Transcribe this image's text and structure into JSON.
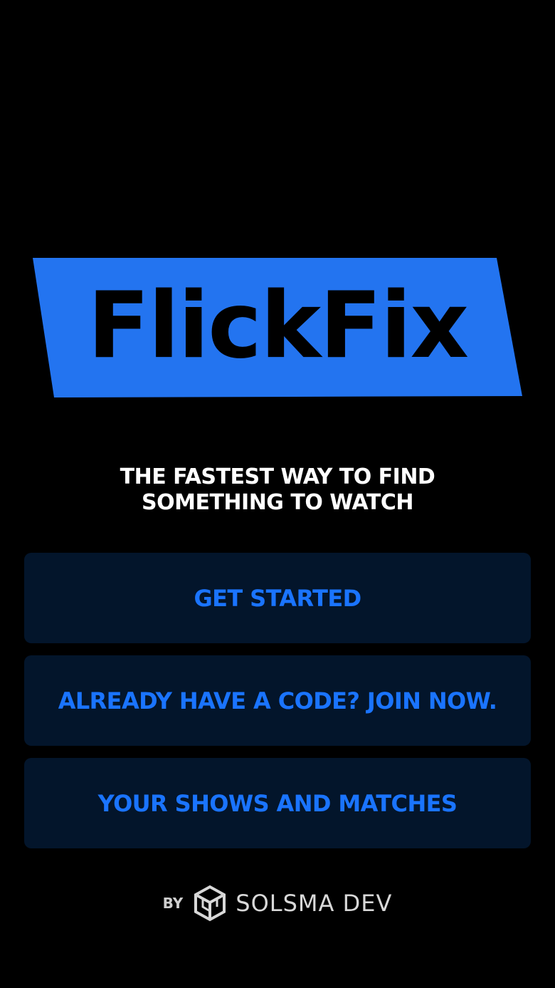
{
  "app": {
    "logo_text": "FlickFix",
    "brand_color": "#2374f0"
  },
  "tagline": {
    "line1": "THE FASTEST WAY TO FIND",
    "line2": "SOMETHING TO WATCH"
  },
  "buttons": {
    "get_started": "GET STARTED",
    "join_with_code": "ALREADY HAVE A CODE? JOIN NOW.",
    "shows_and_matches": "YOUR SHOWS AND MATCHES"
  },
  "footer": {
    "by_label": "BY",
    "developer_name": "SOLSMA DEV",
    "developer_logo_icon": "hexagon-cube-icon"
  },
  "colors": {
    "background": "#000000",
    "button_background": "#03152b",
    "button_text": "#1a74ff",
    "tagline_text": "#ffffff"
  }
}
